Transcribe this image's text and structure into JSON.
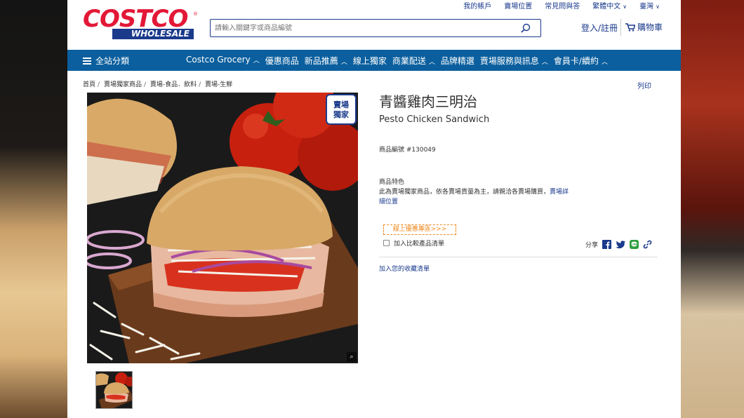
{
  "header": {
    "util_links": [
      "我的帳戶",
      "賣場位置",
      "常見問與答",
      "繁體中文",
      "臺灣"
    ],
    "logo_top": "COSTCO",
    "logo_bottom": "WHOLESALE",
    "search_placeholder": "請輸入關鍵字或商品編號",
    "login": "登入/註冊",
    "cart": "購物車"
  },
  "nav": {
    "all": "全站分類",
    "items": [
      "Costco Grocery",
      "優惠商品",
      "新品推薦",
      "線上獨家",
      "商業配送",
      "品牌精選",
      "賣場服務與訊息",
      "會員卡/續約"
    ]
  },
  "breadcrumb": [
    "首頁",
    "賣場獨家商品",
    "賣場-食品．飲料",
    "賣場-生鮮"
  ],
  "print": "列印",
  "product": {
    "badge_line1": "賣場",
    "badge_line2": "獨家",
    "title_zh": "青醬雞肉三明治",
    "title_en": "Pesto Chicken Sandwich",
    "sku": "商品編號 #130049",
    "features_heading": "商品特色",
    "features_text": "此為賣場獨家商品，依各賣場貨量為主，請親洽各賣場購買，",
    "features_link": "賣場詳細位置",
    "promo": "線上優惠專區>>>",
    "compare": "加入比較產品清單",
    "share": "分享",
    "wishlist": "加入您的收藏清單"
  },
  "colors": {
    "brand_red": "#e31837",
    "brand_blue": "#1a3a8c",
    "nav_blue": "#0b5f9e",
    "promo_orange": "#f08a20"
  }
}
